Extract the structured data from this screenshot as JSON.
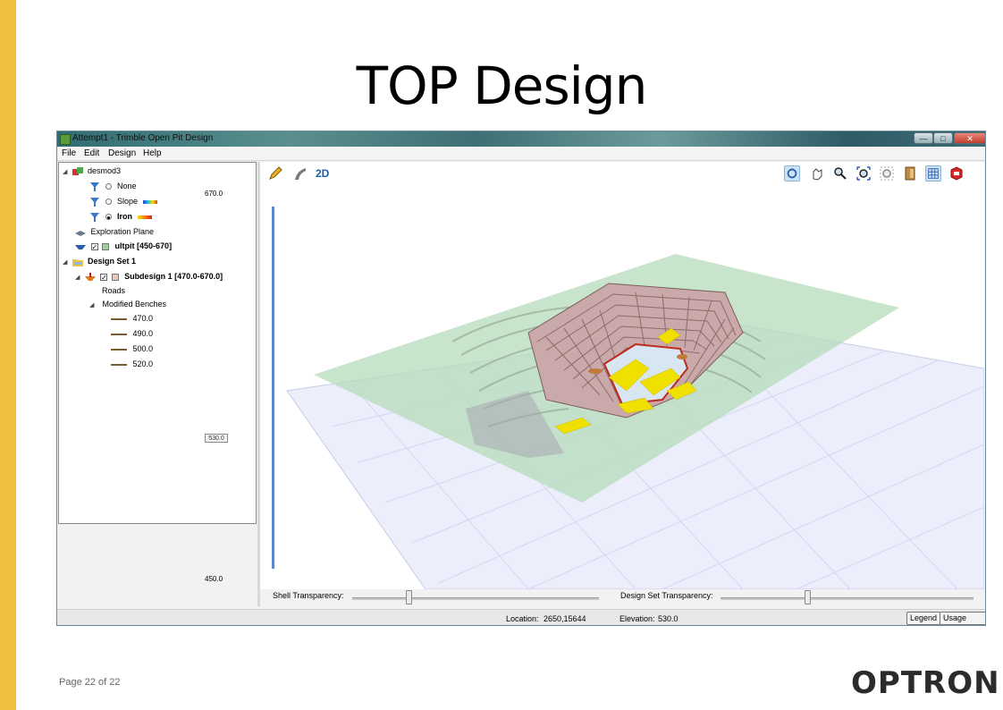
{
  "slide": {
    "title": "TOP Design",
    "page_label": "Page 22 of 22",
    "brand": "OPTRON"
  },
  "window": {
    "title": "Attempt1 - Trimble Open Pit Design",
    "controls": {
      "minimize": "—",
      "maximize": "□",
      "close": "✕"
    }
  },
  "menu": [
    "File",
    "Edit",
    "Design",
    "Help"
  ],
  "tree": {
    "root": "desmod3",
    "model_items": [
      {
        "label": "None",
        "selected": false
      },
      {
        "label": "Slope",
        "selected": false
      },
      {
        "label": "Iron",
        "selected": true
      }
    ],
    "exploration_plane": "Exploration Plane",
    "ultpit": "ultpit [450-670]",
    "design_set": "Design Set 1",
    "subdesign": "Subdesign 1 [470.0-670.0]",
    "roads": "Roads",
    "modified_benches": "Modified Benches",
    "benches": [
      "470.0",
      "490.0",
      "500.0",
      "520.0"
    ]
  },
  "toolbar": {
    "mode_label": "2D",
    "icons": [
      "pencil-icon",
      "ramp-icon",
      "rotate-icon",
      "pan-icon",
      "zoom-icon",
      "zoom-extents-icon",
      "zoom-selection-icon",
      "door-icon",
      "grid-icon",
      "sketchup-icon"
    ]
  },
  "elevation": {
    "max": "670.0",
    "min": "450.0",
    "current": "530.0"
  },
  "sliders": {
    "shell_label": "Shell Transparency:",
    "design_set_label": "Design Set Transparency:"
  },
  "status": {
    "location_label": "Location:",
    "location_value": "2650,15644",
    "elevation_label": "Elevation:",
    "elevation_value": "530.0",
    "legend_button": "Legend",
    "tips_button": "Usage Tips"
  },
  "colors": {
    "accent_bar": "#f0c040",
    "selection_blue": "#5b86c8",
    "ore": "#f0e000",
    "pit_wall": "#b89898",
    "plane": "#9ecfa8"
  }
}
